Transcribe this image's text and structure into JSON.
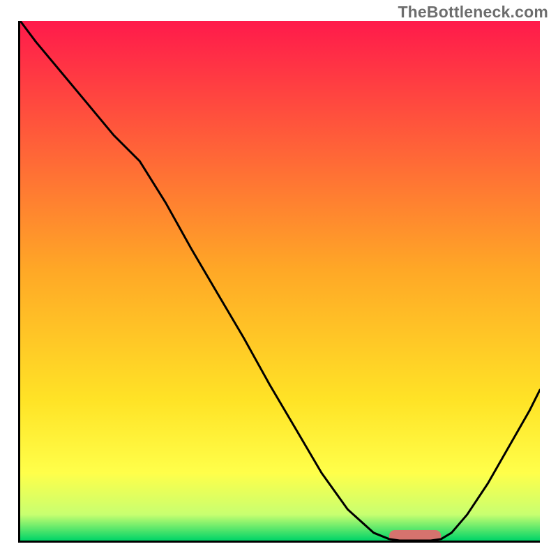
{
  "watermark": "TheBottleneck.com",
  "chart_data": {
    "type": "line",
    "title": "",
    "xlabel": "",
    "ylabel": "",
    "xlim": [
      0,
      100
    ],
    "ylim": [
      0,
      100
    ],
    "x": [
      0,
      3,
      8,
      13,
      18,
      23,
      28,
      33,
      38,
      43,
      48,
      53,
      58,
      63,
      68,
      71,
      73,
      75,
      77,
      79,
      81,
      83,
      86,
      90,
      94,
      98,
      100
    ],
    "values": [
      100,
      96,
      90,
      84,
      78,
      73,
      65,
      56,
      47.5,
      39,
      30,
      21.5,
      13,
      6,
      1.5,
      0.3,
      0,
      0,
      0,
      0,
      0.3,
      1.5,
      5,
      11,
      18,
      25,
      29
    ],
    "marker": {
      "shape": "rounded-rect",
      "color": "#d6736e",
      "x_start": 71,
      "x_end": 81,
      "y": 0
    },
    "baseline_band": {
      "color_top": "#ffff9a",
      "color_bottom": "#00d468",
      "y_start": 0,
      "y_end": 15
    },
    "gradient": {
      "top": "#ff1a4b",
      "mid": "#ffc726",
      "mid2": "#ffff4a",
      "bottom": "#00d468"
    }
  }
}
